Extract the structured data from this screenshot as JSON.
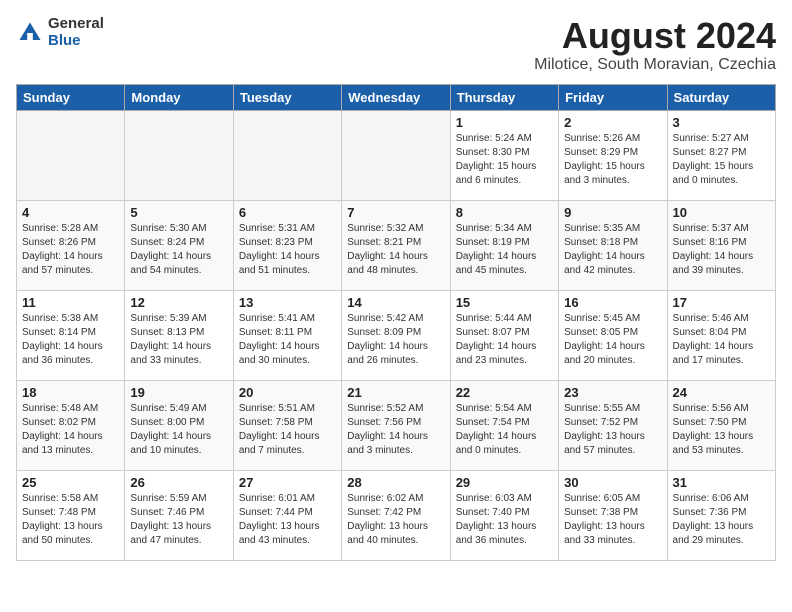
{
  "header": {
    "logo_general": "General",
    "logo_blue": "Blue",
    "month_title": "August 2024",
    "location": "Milotice, South Moravian, Czechia"
  },
  "weekdays": [
    "Sunday",
    "Monday",
    "Tuesday",
    "Wednesday",
    "Thursday",
    "Friday",
    "Saturday"
  ],
  "weeks": [
    [
      {
        "day": "",
        "info": ""
      },
      {
        "day": "",
        "info": ""
      },
      {
        "day": "",
        "info": ""
      },
      {
        "day": "",
        "info": ""
      },
      {
        "day": "1",
        "info": "Sunrise: 5:24 AM\nSunset: 8:30 PM\nDaylight: 15 hours\nand 6 minutes."
      },
      {
        "day": "2",
        "info": "Sunrise: 5:26 AM\nSunset: 8:29 PM\nDaylight: 15 hours\nand 3 minutes."
      },
      {
        "day": "3",
        "info": "Sunrise: 5:27 AM\nSunset: 8:27 PM\nDaylight: 15 hours\nand 0 minutes."
      }
    ],
    [
      {
        "day": "4",
        "info": "Sunrise: 5:28 AM\nSunset: 8:26 PM\nDaylight: 14 hours\nand 57 minutes."
      },
      {
        "day": "5",
        "info": "Sunrise: 5:30 AM\nSunset: 8:24 PM\nDaylight: 14 hours\nand 54 minutes."
      },
      {
        "day": "6",
        "info": "Sunrise: 5:31 AM\nSunset: 8:23 PM\nDaylight: 14 hours\nand 51 minutes."
      },
      {
        "day": "7",
        "info": "Sunrise: 5:32 AM\nSunset: 8:21 PM\nDaylight: 14 hours\nand 48 minutes."
      },
      {
        "day": "8",
        "info": "Sunrise: 5:34 AM\nSunset: 8:19 PM\nDaylight: 14 hours\nand 45 minutes."
      },
      {
        "day": "9",
        "info": "Sunrise: 5:35 AM\nSunset: 8:18 PM\nDaylight: 14 hours\nand 42 minutes."
      },
      {
        "day": "10",
        "info": "Sunrise: 5:37 AM\nSunset: 8:16 PM\nDaylight: 14 hours\nand 39 minutes."
      }
    ],
    [
      {
        "day": "11",
        "info": "Sunrise: 5:38 AM\nSunset: 8:14 PM\nDaylight: 14 hours\nand 36 minutes."
      },
      {
        "day": "12",
        "info": "Sunrise: 5:39 AM\nSunset: 8:13 PM\nDaylight: 14 hours\nand 33 minutes."
      },
      {
        "day": "13",
        "info": "Sunrise: 5:41 AM\nSunset: 8:11 PM\nDaylight: 14 hours\nand 30 minutes."
      },
      {
        "day": "14",
        "info": "Sunrise: 5:42 AM\nSunset: 8:09 PM\nDaylight: 14 hours\nand 26 minutes."
      },
      {
        "day": "15",
        "info": "Sunrise: 5:44 AM\nSunset: 8:07 PM\nDaylight: 14 hours\nand 23 minutes."
      },
      {
        "day": "16",
        "info": "Sunrise: 5:45 AM\nSunset: 8:05 PM\nDaylight: 14 hours\nand 20 minutes."
      },
      {
        "day": "17",
        "info": "Sunrise: 5:46 AM\nSunset: 8:04 PM\nDaylight: 14 hours\nand 17 minutes."
      }
    ],
    [
      {
        "day": "18",
        "info": "Sunrise: 5:48 AM\nSunset: 8:02 PM\nDaylight: 14 hours\nand 13 minutes."
      },
      {
        "day": "19",
        "info": "Sunrise: 5:49 AM\nSunset: 8:00 PM\nDaylight: 14 hours\nand 10 minutes."
      },
      {
        "day": "20",
        "info": "Sunrise: 5:51 AM\nSunset: 7:58 PM\nDaylight: 14 hours\nand 7 minutes."
      },
      {
        "day": "21",
        "info": "Sunrise: 5:52 AM\nSunset: 7:56 PM\nDaylight: 14 hours\nand 3 minutes."
      },
      {
        "day": "22",
        "info": "Sunrise: 5:54 AM\nSunset: 7:54 PM\nDaylight: 14 hours\nand 0 minutes."
      },
      {
        "day": "23",
        "info": "Sunrise: 5:55 AM\nSunset: 7:52 PM\nDaylight: 13 hours\nand 57 minutes."
      },
      {
        "day": "24",
        "info": "Sunrise: 5:56 AM\nSunset: 7:50 PM\nDaylight: 13 hours\nand 53 minutes."
      }
    ],
    [
      {
        "day": "25",
        "info": "Sunrise: 5:58 AM\nSunset: 7:48 PM\nDaylight: 13 hours\nand 50 minutes."
      },
      {
        "day": "26",
        "info": "Sunrise: 5:59 AM\nSunset: 7:46 PM\nDaylight: 13 hours\nand 47 minutes."
      },
      {
        "day": "27",
        "info": "Sunrise: 6:01 AM\nSunset: 7:44 PM\nDaylight: 13 hours\nand 43 minutes."
      },
      {
        "day": "28",
        "info": "Sunrise: 6:02 AM\nSunset: 7:42 PM\nDaylight: 13 hours\nand 40 minutes."
      },
      {
        "day": "29",
        "info": "Sunrise: 6:03 AM\nSunset: 7:40 PM\nDaylight: 13 hours\nand 36 minutes."
      },
      {
        "day": "30",
        "info": "Sunrise: 6:05 AM\nSunset: 7:38 PM\nDaylight: 13 hours\nand 33 minutes."
      },
      {
        "day": "31",
        "info": "Sunrise: 6:06 AM\nSunset: 7:36 PM\nDaylight: 13 hours\nand 29 minutes."
      }
    ]
  ]
}
